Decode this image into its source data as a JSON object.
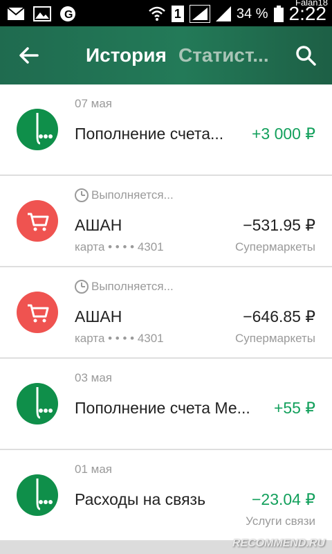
{
  "statusbar": {
    "battery": "34 %",
    "time": "2:22",
    "user": "Falan18",
    "sim": "1"
  },
  "appbar": {
    "tab_history": "История",
    "tab_stats": "Статист..."
  },
  "transactions": [
    {
      "status": "07 мая",
      "pending": false,
      "title": "Пополнение счета...",
      "amount": "+3 000 ₽",
      "positive": true,
      "sub": "",
      "category": "",
      "icon": "mts-logo-icon"
    },
    {
      "status": "Выполняется...",
      "pending": true,
      "title": "АШАН",
      "amount": "−531.95 ₽",
      "positive": false,
      "sub": "карта • • • • 4301",
      "category": "Супермаркеты",
      "icon": "cart-icon"
    },
    {
      "status": "Выполняется...",
      "pending": true,
      "title": "АШАН",
      "amount": "−646.85 ₽",
      "positive": false,
      "sub": "карта • • • • 4301",
      "category": "Супермаркеты",
      "icon": "cart-icon"
    },
    {
      "status": "03 мая",
      "pending": false,
      "title": "Пополнение счета Ме...",
      "amount": "+55 ₽",
      "positive": true,
      "sub": "",
      "category": "",
      "icon": "mts-logo-icon"
    },
    {
      "status": "01 мая",
      "pending": false,
      "title": "Расходы на связь",
      "amount": "−23.04 ₽",
      "positive": true,
      "sub": "",
      "category": "Услуги связи",
      "icon": "mts-logo-icon"
    }
  ],
  "watermark": "RECOMMEND.RU"
}
